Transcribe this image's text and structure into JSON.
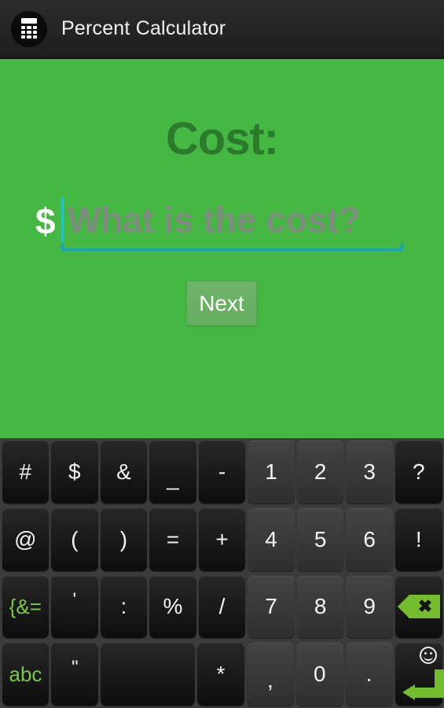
{
  "titlebar": {
    "icon": "calculator-icon",
    "title": "Percent Calculator"
  },
  "colors": {
    "background_green": "#44b843",
    "heading_green": "#2c7b2c",
    "accent_teal": "#1ba3b3",
    "caret_teal": "#21c6c0",
    "key_green": "#7ac943",
    "titlebar_dark": "#1d1d1d"
  },
  "main": {
    "heading": "Cost:",
    "currency_symbol": "$",
    "input": {
      "value": "",
      "placeholder": "What is the cost?"
    },
    "next_label": "Next"
  },
  "keyboard": {
    "rows": [
      [
        {
          "label": "#",
          "name": "key-hash",
          "type": "symbol"
        },
        {
          "label": "$",
          "name": "key-dollar",
          "type": "symbol"
        },
        {
          "label": "&",
          "name": "key-ampersand",
          "type": "symbol"
        },
        {
          "label": "_",
          "name": "key-underscore",
          "type": "symbol"
        },
        {
          "label": "-",
          "name": "key-hyphen",
          "type": "symbol"
        },
        {
          "label": "1",
          "name": "key-1",
          "type": "numeric"
        },
        {
          "label": "2",
          "name": "key-2",
          "type": "numeric"
        },
        {
          "label": "3",
          "name": "key-3",
          "type": "numeric"
        },
        {
          "label": "?",
          "name": "key-question",
          "type": "symbol"
        }
      ],
      [
        {
          "label": "@",
          "name": "key-at",
          "type": "symbol"
        },
        {
          "label": "(",
          "name": "key-paren-open",
          "type": "symbol"
        },
        {
          "label": ")",
          "name": "key-paren-close",
          "type": "symbol"
        },
        {
          "label": "=",
          "name": "key-equals",
          "type": "symbol"
        },
        {
          "label": "+",
          "name": "key-plus",
          "type": "symbol"
        },
        {
          "label": "4",
          "name": "key-4",
          "type": "numeric"
        },
        {
          "label": "5",
          "name": "key-5",
          "type": "numeric"
        },
        {
          "label": "6",
          "name": "key-6",
          "type": "numeric"
        },
        {
          "label": "!",
          "name": "key-exclamation",
          "type": "symbol"
        }
      ],
      [
        {
          "label": "{&=",
          "name": "key-symbols-page",
          "type": "green-label"
        },
        {
          "label": "'",
          "name": "key-apostrophe",
          "type": "symbol"
        },
        {
          "label": ":",
          "name": "key-colon",
          "type": "symbol"
        },
        {
          "label": "%",
          "name": "key-percent",
          "type": "symbol"
        },
        {
          "label": "/",
          "name": "key-slash",
          "type": "symbol"
        },
        {
          "label": "7",
          "name": "key-7",
          "type": "numeric"
        },
        {
          "label": "8",
          "name": "key-8",
          "type": "numeric"
        },
        {
          "label": "9",
          "name": "key-9",
          "type": "numeric"
        },
        {
          "label": "",
          "name": "key-backspace",
          "type": "backspace"
        }
      ],
      [
        {
          "label": "abc",
          "name": "key-abc-page",
          "type": "green-label"
        },
        {
          "label": "\"",
          "name": "key-quote",
          "type": "symbol"
        },
        {
          "label": "",
          "name": "key-space",
          "type": "space"
        },
        {
          "label": "*",
          "name": "key-asterisk",
          "type": "symbol"
        },
        {
          "label": ",",
          "name": "key-comma",
          "type": "numeric"
        },
        {
          "label": "0",
          "name": "key-0",
          "type": "numeric"
        },
        {
          "label": ".",
          "name": "key-period",
          "type": "numeric"
        },
        {
          "label": "",
          "name": "key-enter",
          "type": "enter"
        }
      ]
    ]
  }
}
